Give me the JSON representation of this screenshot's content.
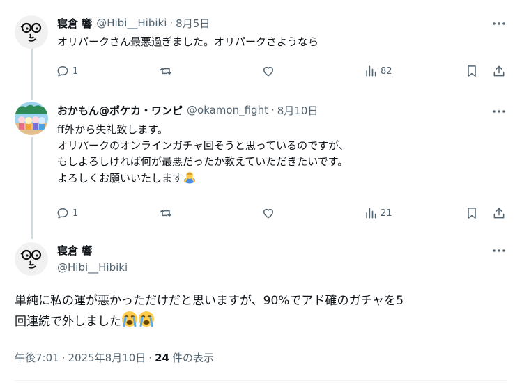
{
  "tweet1": {
    "display_name": "寝倉 響",
    "handle": "@Hibi__Hibiki",
    "separator": "·",
    "date": "8月5日",
    "lines": [
      "オリパークさん最悪過ぎました。オリパークさようなら"
    ],
    "reply_count": "1",
    "view_count": "82"
  },
  "tweet2": {
    "display_name": "おかもん@ポケカ・ワンピ",
    "handle": "@okamon_fight",
    "separator": "·",
    "date": "8月10日",
    "lines": [
      "ff外から失礼致します。",
      "オリパークのオンラインガチャ回そうと思っているのですが、",
      "もしよろしければ何が最悪だったか教えていただきたいです。",
      "よろしくお願いいたします"
    ],
    "reply_count": "1",
    "view_count": "21"
  },
  "main_tweet": {
    "display_name": "寝倉 響",
    "handle": "@Hibi__Hibiki",
    "lines": [
      "単純に私の運が悪かっただけだと思いますが、90%でアド確のガチャを5",
      "回連続で外しました"
    ],
    "time": "午後7:01",
    "separator": "·",
    "date": "2025年8月10日",
    "view_count": "24",
    "view_label": "件の表示"
  },
  "icons": {
    "more": "more-horizontal-icon",
    "reply": "reply-icon",
    "retweet": "retweet-icon",
    "like": "like-icon",
    "views": "views-icon",
    "bookmark": "bookmark-icon",
    "share": "share-icon",
    "emoji_bow": "bowing-person-emoji",
    "emoji_cry": "loudly-crying-face-emoji"
  },
  "colors": {
    "text": "#0f1419",
    "secondary": "#536471",
    "thread_line": "#cfd9de"
  }
}
